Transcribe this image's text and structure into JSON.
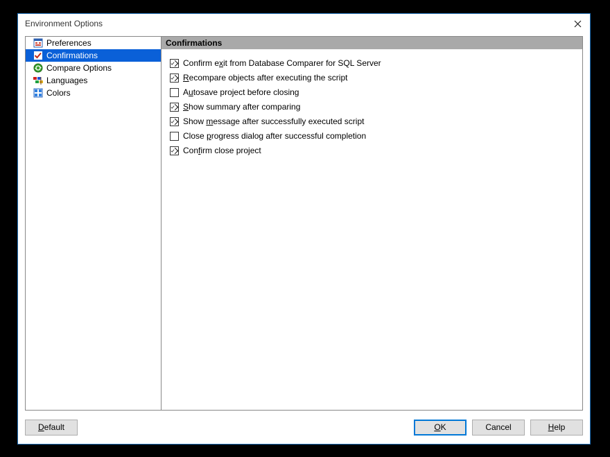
{
  "window": {
    "title": "Environment Options"
  },
  "nav": {
    "items": [
      {
        "label": "Preferences",
        "selected": false,
        "icon": "preferences"
      },
      {
        "label": "Confirmations",
        "selected": true,
        "icon": "confirmations"
      },
      {
        "label": "Compare Options",
        "selected": false,
        "icon": "compare"
      },
      {
        "label": "Languages",
        "selected": false,
        "icon": "languages"
      },
      {
        "label": "Colors",
        "selected": false,
        "icon": "colors"
      }
    ]
  },
  "content": {
    "header": "Confirmations",
    "checkboxes": [
      {
        "label_pre": "Confirm e",
        "mnemonic": "x",
        "label_post": "it from Database Comparer for SQL Server",
        "checked": true
      },
      {
        "label_pre": "",
        "mnemonic": "R",
        "label_post": "ecompare objects after executing the script",
        "checked": true
      },
      {
        "label_pre": "A",
        "mnemonic": "u",
        "label_post": "tosave project before closing",
        "checked": false
      },
      {
        "label_pre": "",
        "mnemonic": "S",
        "label_post": "how summary after comparing",
        "checked": true
      },
      {
        "label_pre": "Show ",
        "mnemonic": "m",
        "label_post": "essage after successfully executed script",
        "checked": true
      },
      {
        "label_pre": "Close ",
        "mnemonic": "p",
        "label_post": "rogress dialog after successful completion",
        "checked": false
      },
      {
        "label_pre": "Con",
        "mnemonic": "f",
        "label_post": "irm close project",
        "checked": true
      }
    ]
  },
  "buttons": {
    "default_pre": "",
    "default_mn": "D",
    "default_post": "efault",
    "ok_pre": "",
    "ok_mn": "O",
    "ok_post": "K",
    "cancel": "Cancel",
    "help_pre": "",
    "help_mn": "H",
    "help_post": "elp"
  }
}
